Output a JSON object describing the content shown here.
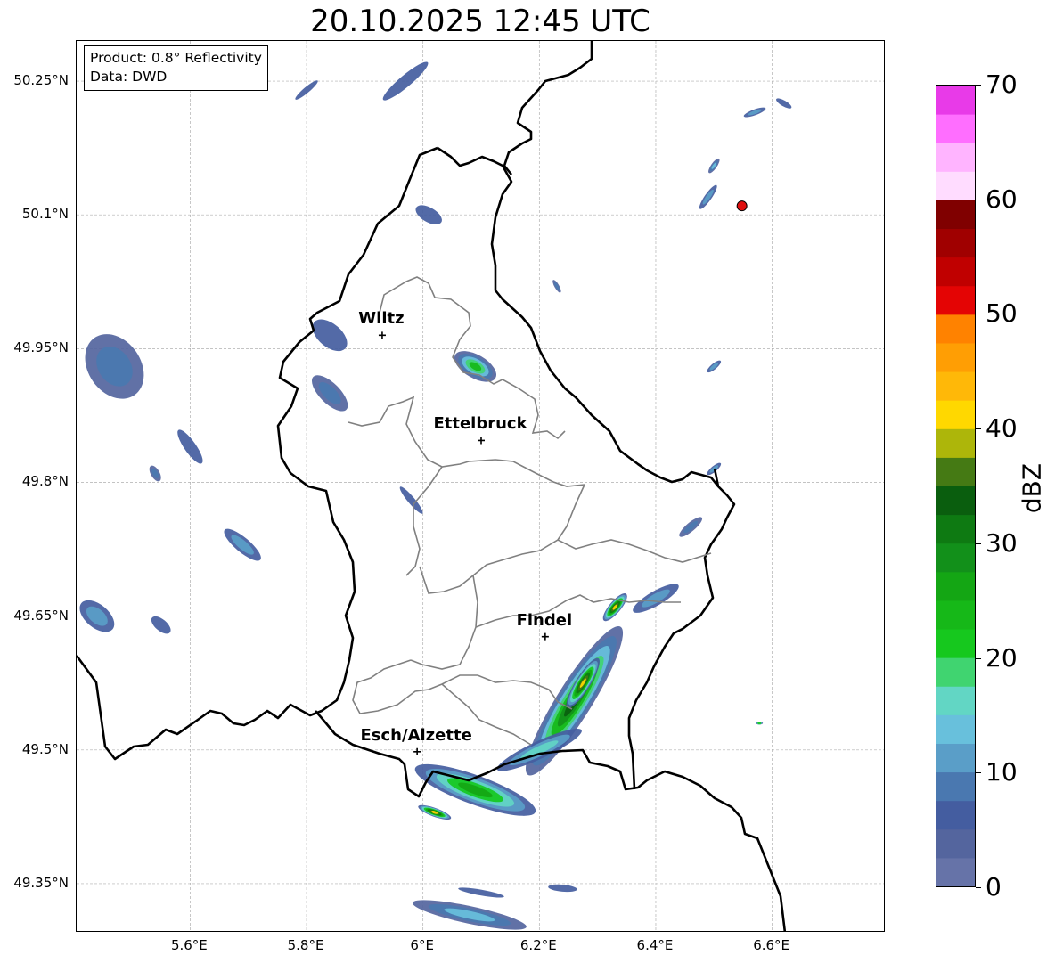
{
  "title": "20.10.2025 12:45 UTC",
  "info_box": {
    "line1": "Product: 0.8° Reflectivity",
    "line2": "Data: DWD"
  },
  "map_extent": {
    "lon_min": 5.405,
    "lon_max": 6.795,
    "lat_min": 49.295,
    "lat_max": 50.295
  },
  "lon_ticks": [
    {
      "value": 5.6,
      "label": "5.6°E"
    },
    {
      "value": 5.8,
      "label": "5.8°E"
    },
    {
      "value": 6.0,
      "label": "6°E"
    },
    {
      "value": 6.2,
      "label": "6.2°E"
    },
    {
      "value": 6.4,
      "label": "6.4°E"
    },
    {
      "value": 6.6,
      "label": "6.6°E"
    }
  ],
  "lat_ticks": [
    {
      "value": 50.25,
      "label": "50.25°N"
    },
    {
      "value": 50.1,
      "label": "50.1°N"
    },
    {
      "value": 49.95,
      "label": "49.95°N"
    },
    {
      "value": 49.8,
      "label": "49.8°N"
    },
    {
      "value": 49.65,
      "label": "49.65°N"
    },
    {
      "value": 49.5,
      "label": "49.5°N"
    },
    {
      "value": 49.35,
      "label": "49.35°N"
    }
  ],
  "cities": [
    {
      "name": "Wiltz",
      "lon": 5.93,
      "lat": 49.965
    },
    {
      "name": "Ettelbruck",
      "lon": 6.1,
      "lat": 49.847
    },
    {
      "name": "Findel",
      "lon": 6.21,
      "lat": 49.627
    },
    {
      "name": "Esch/Alzette",
      "lon": 5.99,
      "lat": 49.498
    }
  ],
  "radar_site": {
    "lon": 6.548,
    "lat": 50.11,
    "color": "#e01010"
  },
  "colorbar": {
    "label": "dBZ",
    "min": 0,
    "max": 70,
    "step": 2.5,
    "ticks": [
      {
        "value": 0,
        "label": "0"
      },
      {
        "value": 10,
        "label": "10"
      },
      {
        "value": 20,
        "label": "20"
      },
      {
        "value": 30,
        "label": "30"
      },
      {
        "value": 40,
        "label": "40"
      },
      {
        "value": 50,
        "label": "50"
      },
      {
        "value": 60,
        "label": "60"
      },
      {
        "value": 70,
        "label": "70"
      }
    ],
    "colors": [
      "#6673a8",
      "#54659e",
      "#445da0",
      "#4a78b0",
      "#5a9ec8",
      "#68c0dc",
      "#62d6c4",
      "#40d470",
      "#16c81e",
      "#16b818",
      "#14a614",
      "#12901a",
      "#0e7a12",
      "#0a5e0e",
      "#457a14",
      "#adb60a",
      "#ffd800",
      "#ffb808",
      "#ff9e04",
      "#ff8200",
      "#e40404",
      "#c00000",
      "#a00000",
      "#800000",
      "#ffdcff",
      "#ffb4ff",
      "#ff6eff",
      "#e83ae8"
    ]
  },
  "reflectivity_cells": [
    {
      "lon": 6.26,
      "lat": 49.555,
      "len": 0.3,
      "wid": 0.06,
      "angle": 58,
      "dbz": 34
    },
    {
      "lon": 6.275,
      "lat": 49.575,
      "len": 0.1,
      "wid": 0.025,
      "angle": 58,
      "dbz": 42
    },
    {
      "lon": 6.33,
      "lat": 49.66,
      "len": 0.06,
      "wid": 0.02,
      "angle": 50,
      "dbz": 42
    },
    {
      "lon": 6.4,
      "lat": 49.67,
      "len": 0.09,
      "wid": 0.025,
      "angle": 30,
      "dbz": 12
    },
    {
      "lon": 6.2,
      "lat": 49.5,
      "len": 0.16,
      "wid": 0.03,
      "angle": 25,
      "dbz": 16
    },
    {
      "lon": 6.09,
      "lat": 49.455,
      "len": 0.22,
      "wid": 0.05,
      "angle": -20,
      "dbz": 26
    },
    {
      "lon": 6.02,
      "lat": 49.43,
      "len": 0.06,
      "wid": 0.015,
      "angle": -20,
      "dbz": 42
    },
    {
      "lon": 6.08,
      "lat": 49.315,
      "len": 0.2,
      "wid": 0.03,
      "angle": -12,
      "dbz": 14
    },
    {
      "lon": 6.24,
      "lat": 49.345,
      "len": 0.05,
      "wid": 0.012,
      "angle": -5,
      "dbz": 6
    },
    {
      "lon": 6.1,
      "lat": 49.34,
      "len": 0.08,
      "wid": 0.01,
      "angle": -10,
      "dbz": 6
    },
    {
      "lon": 6.09,
      "lat": 49.93,
      "len": 0.08,
      "wid": 0.04,
      "angle": -30,
      "dbz": 24
    },
    {
      "lon": 5.84,
      "lat": 49.965,
      "len": 0.07,
      "wid": 0.04,
      "angle": -40,
      "dbz": 6
    },
    {
      "lon": 5.84,
      "lat": 49.9,
      "len": 0.08,
      "wid": 0.035,
      "angle": -45,
      "dbz": 8
    },
    {
      "lon": 5.47,
      "lat": 49.93,
      "len": 0.12,
      "wid": 0.09,
      "angle": -55,
      "dbz": 8
    },
    {
      "lon": 5.44,
      "lat": 49.65,
      "len": 0.07,
      "wid": 0.04,
      "angle": -40,
      "dbz": 10
    },
    {
      "lon": 5.55,
      "lat": 49.64,
      "len": 0.04,
      "wid": 0.02,
      "angle": -40,
      "dbz": 6
    },
    {
      "lon": 5.6,
      "lat": 49.84,
      "len": 0.07,
      "wid": 0.02,
      "angle": -55,
      "dbz": 6
    },
    {
      "lon": 5.54,
      "lat": 49.81,
      "len": 0.03,
      "wid": 0.015,
      "angle": -60,
      "dbz": 8
    },
    {
      "lon": 5.69,
      "lat": 49.73,
      "len": 0.08,
      "wid": 0.025,
      "angle": -40,
      "dbz": 10
    },
    {
      "lon": 6.01,
      "lat": 50.1,
      "len": 0.05,
      "wid": 0.025,
      "angle": -30,
      "dbz": 6
    },
    {
      "lon": 5.98,
      "lat": 49.78,
      "len": 0.06,
      "wid": 0.012,
      "angle": -50,
      "dbz": 6
    },
    {
      "lon": 5.97,
      "lat": 50.25,
      "len": 0.1,
      "wid": 0.02,
      "angle": 40,
      "dbz": 6
    },
    {
      "lon": 6.49,
      "lat": 50.12,
      "len": 0.05,
      "wid": 0.012,
      "angle": 55,
      "dbz": 12
    },
    {
      "lon": 6.5,
      "lat": 50.155,
      "len": 0.03,
      "wid": 0.01,
      "angle": 55,
      "dbz": 14
    },
    {
      "lon": 6.57,
      "lat": 50.215,
      "len": 0.04,
      "wid": 0.01,
      "angle": 20,
      "dbz": 10
    },
    {
      "lon": 6.62,
      "lat": 50.225,
      "len": 0.03,
      "wid": 0.01,
      "angle": -30,
      "dbz": 6
    },
    {
      "lon": 6.46,
      "lat": 49.75,
      "len": 0.05,
      "wid": 0.015,
      "angle": 40,
      "dbz": 8
    },
    {
      "lon": 6.5,
      "lat": 49.815,
      "len": 0.03,
      "wid": 0.01,
      "angle": 40,
      "dbz": 12
    },
    {
      "lon": 6.5,
      "lat": 49.93,
      "len": 0.03,
      "wid": 0.01,
      "angle": 40,
      "dbz": 12
    },
    {
      "lon": 6.23,
      "lat": 50.02,
      "len": 0.025,
      "wid": 0.008,
      "angle": -60,
      "dbz": 8
    },
    {
      "lon": 5.8,
      "lat": 50.24,
      "len": 0.05,
      "wid": 0.01,
      "angle": 40,
      "dbz": 6
    },
    {
      "lon": 6.578,
      "lat": 49.53,
      "len": 0.012,
      "wid": 0.004,
      "angle": 0,
      "dbz": 22
    }
  ]
}
